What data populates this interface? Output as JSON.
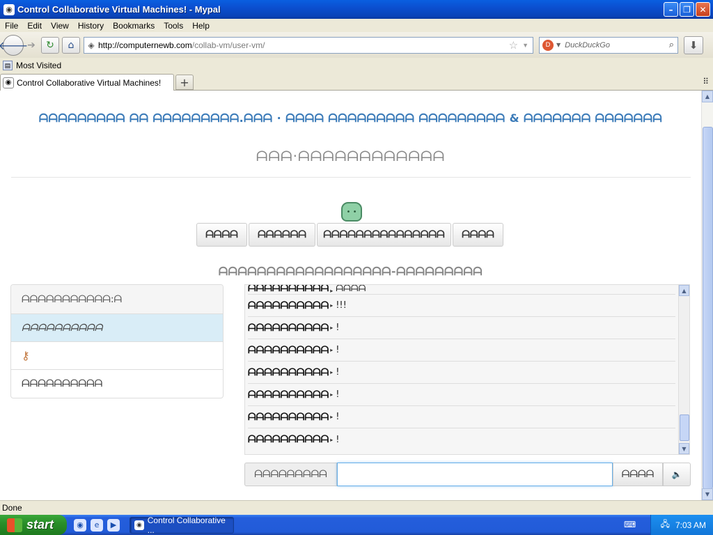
{
  "window": {
    "title": "Control Collaborative Virtual Machines! - Mypal"
  },
  "menu": [
    "File",
    "Edit",
    "View",
    "History",
    "Bookmarks",
    "Tools",
    "Help"
  ],
  "nav": {
    "url_domain": "http://computernewb.com",
    "url_path": "/collab-vm/user-vm/",
    "search_placeholder": "DuckDuckGo"
  },
  "bookmarks": {
    "most_visited": "Most Visited"
  },
  "tabs": [
    {
      "label": "Control Collaborative Virtual Machines!"
    }
  ],
  "page": {
    "heading": "ᗩᗩᗩᗩᗩᗩᗩᗩᗩ ᗩᗩ ᗩᗩᗩᗩᗩᗩᗩᗩᗩ.ᗩᗩᗩ · ᗩᗩᗩᗩ ᗩᗩᗩᗩᗩᗩᗩᗩᗩ ᗩᗩᗩᗩᗩᗩᗩᗩᗩ & ᗩᗩᗩᗩᗩᗩᗩ ᗩᗩᗩᗩᗩᗩᗩ",
    "subheading": "ᗩᗩᗩ·ᗩᗩᗩᗩᗩᗩᗩᗩᗩᗩᗩᗩ",
    "vm_buttons": [
      "ᗩᗩᗩᗩ",
      "ᗩᗩᗩᗩᗩᗩ",
      "ᗩᗩᗩᗩᗩᗩᗩᗩᗩᗩᗩᗩᗩᗩᗩ",
      "ᗩᗩᗩᗩ"
    ],
    "vm_name": "ᗩᗩᗩᗩᗩᗩᗩᗩᗩᗩᗩᗩᗩᗩᗩᗩᗩᗩ-ᗩᗩᗩᗩᗩᗩᗩᗩᗩ"
  },
  "users": {
    "header": "ᗩᗩᗩᗩᗩᗩᗩᗩᗩᗩᗩ:ᗩ",
    "rows": [
      "ᗩᗩᗩᗩᗩᗩᗩᗩᗩᗩ",
      "",
      "ᗩᗩᗩᗩᗩᗩᗩᗩᗩᗩ"
    ]
  },
  "chat": {
    "messages": [
      {
        "user": "ᗩᗩᗩᗩᗩᗩᗩᗩᗩᗩ",
        "text": "ᗩᗩᗩᗩ"
      },
      {
        "user": "ᗩᗩᗩᗩᗩᗩᗩᗩᗩᗩ",
        "text": "!!!"
      },
      {
        "user": "ᗩᗩᗩᗩᗩᗩᗩᗩᗩᗩ",
        "text": "!"
      },
      {
        "user": "ᗩᗩᗩᗩᗩᗩᗩᗩᗩᗩ",
        "text": "!"
      },
      {
        "user": "ᗩᗩᗩᗩᗩᗩᗩᗩᗩᗩ",
        "text": "!"
      },
      {
        "user": "ᗩᗩᗩᗩᗩᗩᗩᗩᗩᗩ",
        "text": "!"
      },
      {
        "user": "ᗩᗩᗩᗩᗩᗩᗩᗩᗩᗩ",
        "text": "!"
      },
      {
        "user": "ᗩᗩᗩᗩᗩᗩᗩᗩᗩᗩ",
        "text": "!"
      }
    ],
    "username_label": "ᗩᗩᗩᗩᗩᗩᗩᗩᗩ",
    "input_value": "",
    "send_label": "ᗩᗩᗩᗩ"
  },
  "status": {
    "text": "Done"
  },
  "taskbar": {
    "start_label": "start",
    "task_label": "Control Collaborative ...",
    "clock": "7:03 AM"
  },
  "icons": {
    "back": "back-arrow-icon",
    "forward": "forward-arrow-icon",
    "reload": "reload-icon",
    "home": "home-icon",
    "bookmark_star": "star-icon",
    "search": "magnifier-icon",
    "download": "download-icon",
    "key": "key-icon",
    "speaker": "speaker-icon"
  },
  "colors": {
    "heading_blue": "#3a7ab8",
    "title_bar": "#0b4fd0",
    "active_row": "#d9edf7",
    "input_focus": "#66afe9"
  }
}
